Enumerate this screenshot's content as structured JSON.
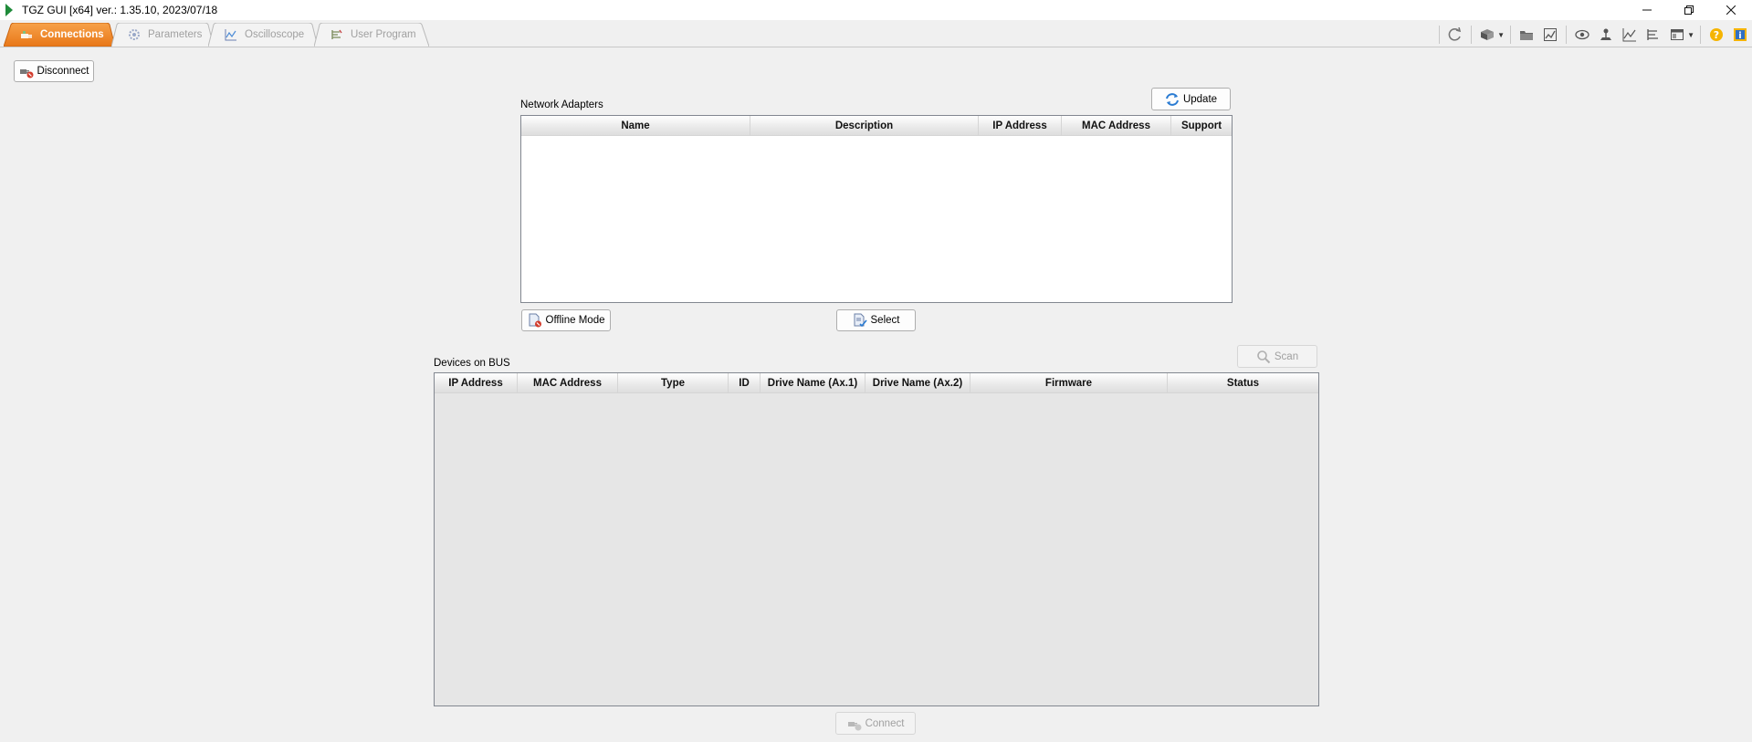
{
  "window": {
    "title": "TGZ GUI [x64]   ver.: 1.35.10,  2023/07/18",
    "controls": [
      "minimize-icon",
      "restore-icon",
      "close-icon"
    ]
  },
  "tabs": [
    {
      "label": "Connections",
      "icon": "plug-icon",
      "active": true
    },
    {
      "label": "Parameters",
      "icon": "gear-icon",
      "active": false
    },
    {
      "label": "Oscilloscope",
      "icon": "chart-icon",
      "active": false
    },
    {
      "label": "User Program",
      "icon": "code-icon",
      "active": false
    }
  ],
  "toolbar": {
    "icons": [
      "refresh-icon",
      "box-icon",
      "folder-icon",
      "image-edit-icon",
      "eye-icon",
      "joystick-icon",
      "chart-icon",
      "list-chart-icon",
      "window-icon",
      "help-icon",
      "info-icon"
    ]
  },
  "disconnect_button": "Disconnect",
  "network": {
    "label": "Network Adapters",
    "update_button": "Update",
    "columns": [
      "Name",
      "Description",
      "IP Address",
      "MAC Address",
      "Support"
    ],
    "rows": [],
    "offline_button": "Offline Mode",
    "select_button": "Select"
  },
  "devices": {
    "label": "Devices on BUS",
    "scan_button": "Scan",
    "columns": [
      "IP Address",
      "MAC Address",
      "Type",
      "ID",
      "Drive Name (Ax.1)",
      "Drive Name (Ax.2)",
      "Firmware",
      "Status"
    ],
    "rows": [],
    "connect_button": "Connect"
  },
  "colors": {
    "active_tab": "#f28c28",
    "window_bg": "#f0f0f0",
    "table_empty_bg": "#e6e6e6"
  }
}
